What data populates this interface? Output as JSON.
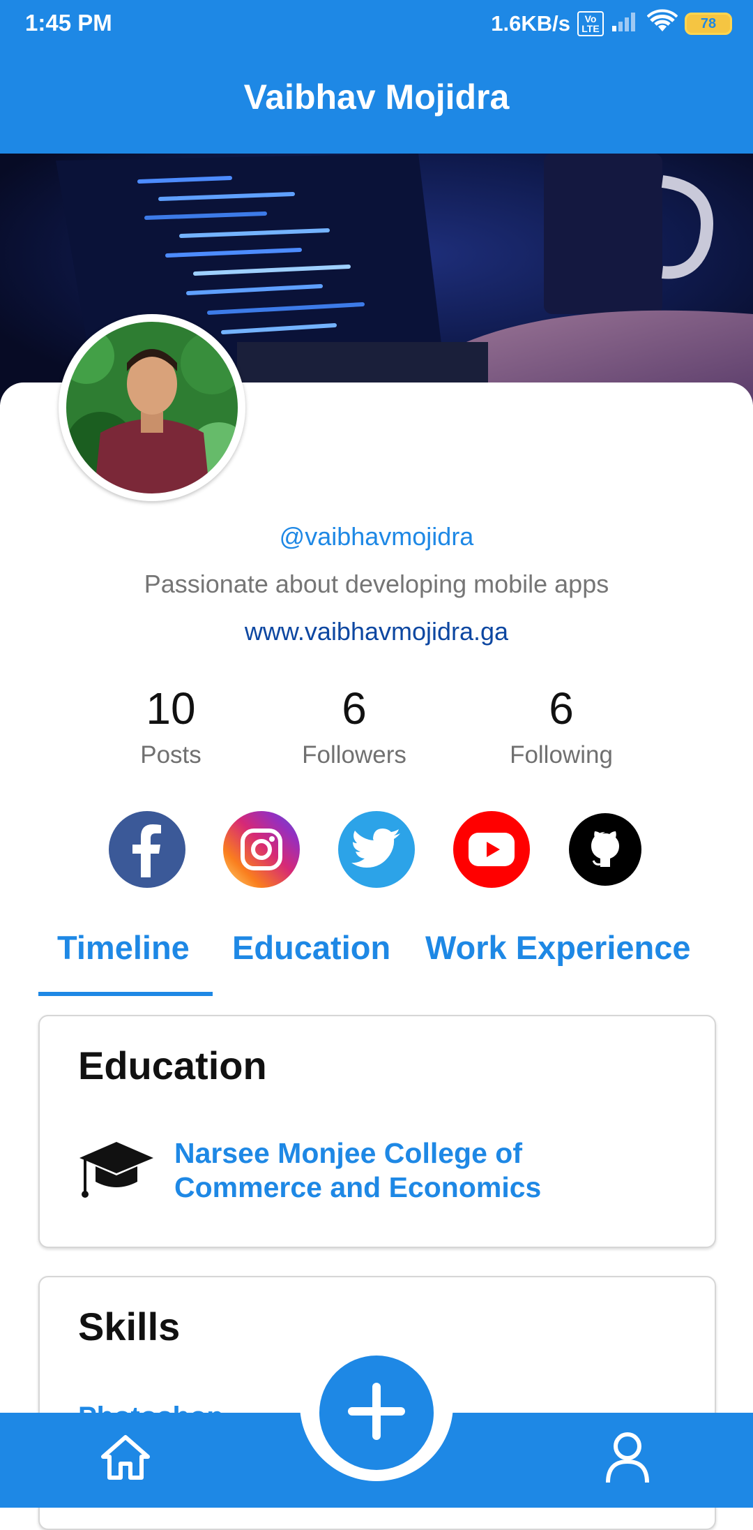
{
  "status_bar": {
    "time": "1:45 PM",
    "network_speed": "1.6KB/s",
    "volte_badge": "Vo LTE",
    "battery": "78"
  },
  "app_bar": {
    "title": "Vaibhav Mojidra"
  },
  "profile": {
    "handle": "@vaibhavmojidra",
    "bio": "Passionate about developing mobile apps",
    "website": "www.vaibhavmojidra.ga"
  },
  "stats": [
    {
      "value": "10",
      "label": "Posts"
    },
    {
      "value": "6",
      "label": "Followers"
    },
    {
      "value": "6",
      "label": "Following"
    }
  ],
  "social_icons": [
    "facebook-icon",
    "instagram-icon",
    "twitter-icon",
    "youtube-icon",
    "github-icon"
  ],
  "tabs": [
    {
      "label": "Timeline",
      "active": true
    },
    {
      "label": "Education",
      "active": false
    },
    {
      "label": "Work Experience",
      "active": false
    }
  ],
  "education_card": {
    "title": "Education",
    "icon": "graduation-cap-icon",
    "institution": "Narsee Monjee College of Commerce and Economics"
  },
  "skills_card": {
    "title": "Skills",
    "first_skill": "Photoshop"
  },
  "bottom_nav": {
    "home_icon": "home-icon",
    "fab_icon": "plus-icon",
    "profile_icon": "person-icon"
  },
  "colors": {
    "primary": "#1e88e5",
    "link_dark": "#0d47a1",
    "secondary_text": "#757575"
  }
}
